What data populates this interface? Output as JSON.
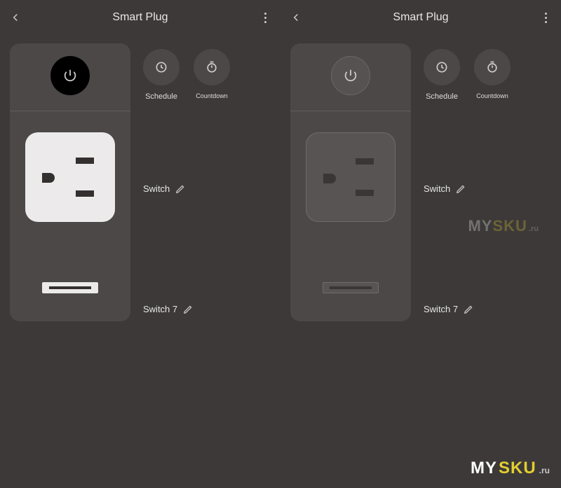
{
  "header": {
    "title": "Smart Plug"
  },
  "actions": {
    "schedule": "Schedule",
    "countdown": "Countdown"
  },
  "switches": {
    "sw1": "Switch",
    "sw2": "Switch 7"
  },
  "watermark": {
    "prefix": "MY",
    "brand": "SKU",
    "tld": ".ru"
  },
  "panes": [
    {
      "state": "on"
    },
    {
      "state": "off"
    }
  ]
}
